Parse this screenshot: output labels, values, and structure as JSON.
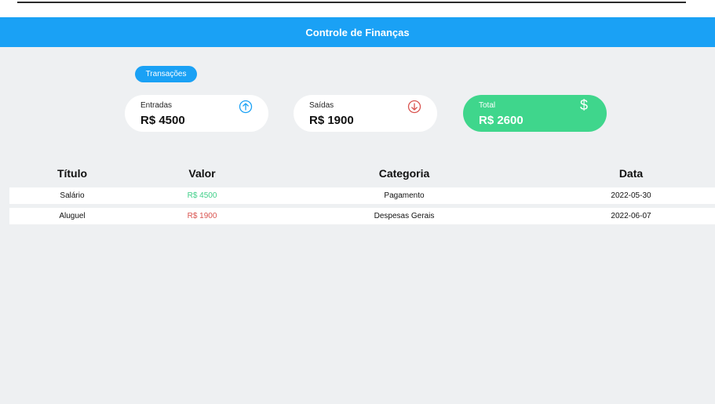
{
  "header": {
    "title": "Controle de Finanças"
  },
  "tabs": {
    "transacoes": "Transações"
  },
  "summary": {
    "entradas": {
      "label": "Entradas",
      "value": "R$ 4500",
      "icon": "arrow-up-circle-icon"
    },
    "saidas": {
      "label": "Saídas",
      "value": "R$ 1900",
      "icon": "arrow-down-circle-icon"
    },
    "total": {
      "label": "Total",
      "value": "R$ 2600",
      "icon": "dollar-icon",
      "symbol": "$"
    }
  },
  "table": {
    "columns": [
      "Título",
      "Valor",
      "Categoria",
      "Data"
    ],
    "rows": [
      {
        "titulo": "Salário",
        "valor": "R$ 4500",
        "categoria": "Pagamento",
        "data": "2022-05-30",
        "type": "in"
      },
      {
        "titulo": "Aluguel",
        "valor": "R$ 1900",
        "categoria": "Despesas Gerais",
        "data": "2022-06-07",
        "type": "out"
      }
    ]
  },
  "colors": {
    "primary": "#1aa1f5",
    "positive": "#3fd68c",
    "negative": "#d9534f",
    "background": "#eef0f2"
  }
}
